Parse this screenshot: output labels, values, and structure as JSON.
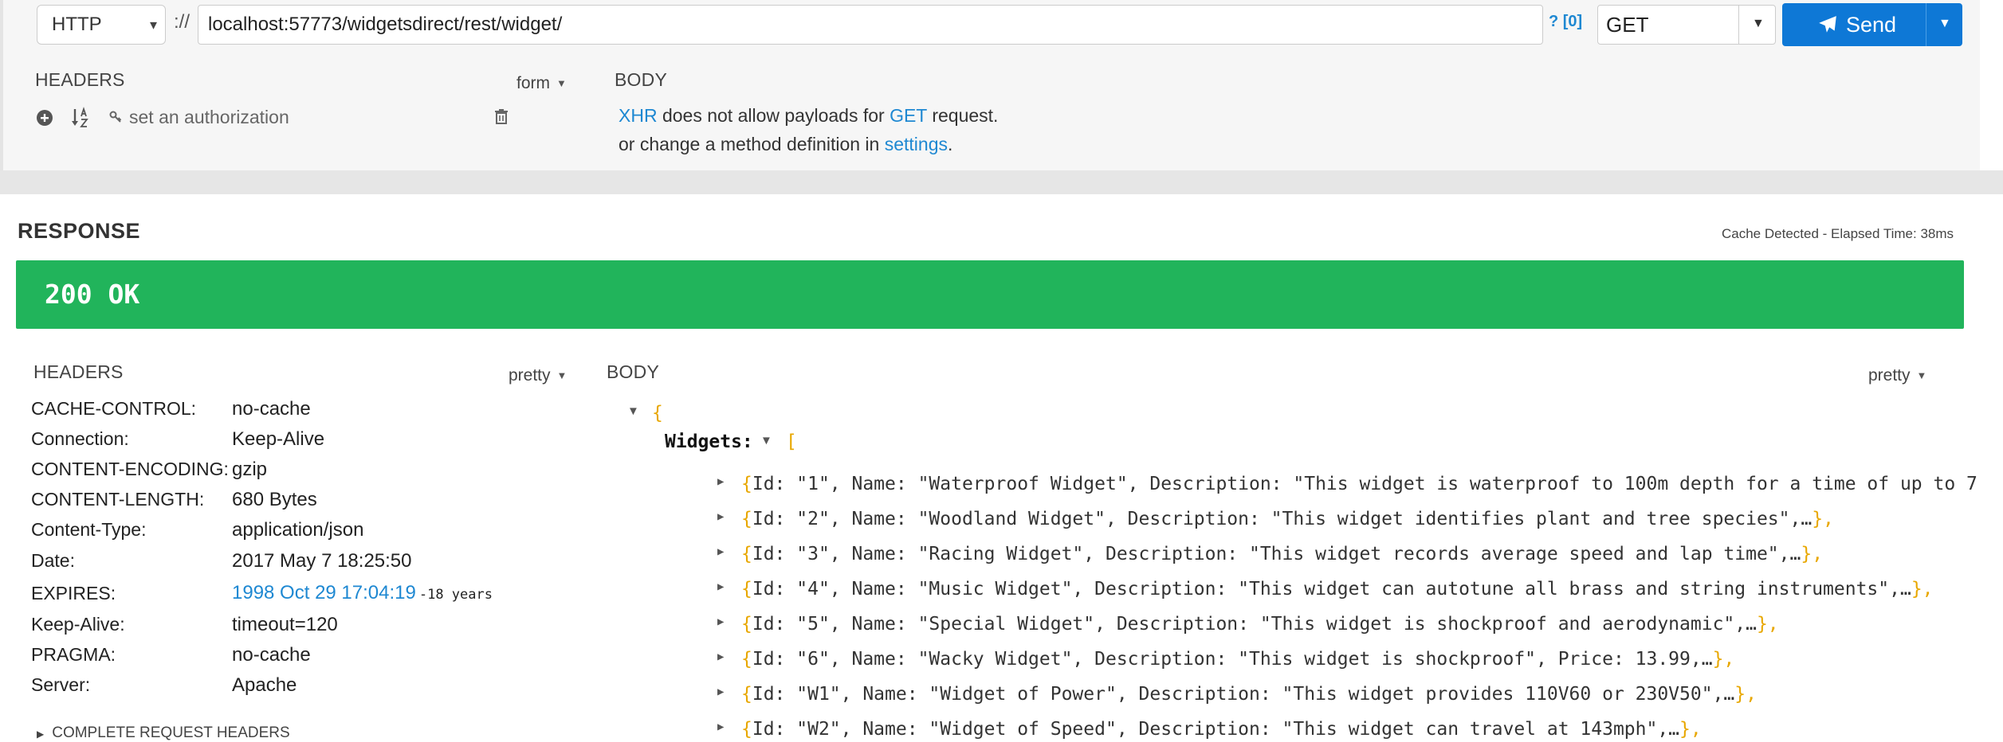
{
  "request": {
    "scheme": "HTTP",
    "separator": "://",
    "url": "localhost:57773/widgetsdirect/rest/widget/",
    "history": "? [0]",
    "method": "GET",
    "send_label": "Send",
    "headers_label": "HEADERS",
    "headers_toggle": "form",
    "auth_placeholder": "set an authorization",
    "body_label": "BODY",
    "body_message": {
      "xhr": "XHR",
      "part1": " does not allow payloads for ",
      "get": "GET",
      "part2": " request.",
      "line2": "or change a method definition in ",
      "settings": "settings",
      "period": "."
    }
  },
  "response": {
    "title": "RESPONSE",
    "elapsed": "Cache Detected - Elapsed Time: 38ms",
    "status": "200 OK",
    "headers_label": "HEADERS",
    "headers_toggle": "pretty",
    "body_label": "BODY",
    "body_toggle": "pretty",
    "headers": [
      {
        "key": "CACHE-CONTROL:",
        "value": "no-cache"
      },
      {
        "key": "Connection:",
        "value": "Keep-Alive"
      },
      {
        "key": "CONTENT-ENCODING:",
        "value": "gzip"
      },
      {
        "key": "CONTENT-LENGTH:",
        "value": "680 Bytes"
      },
      {
        "key": "Content-Type:",
        "value": "application/json"
      },
      {
        "key": "Date:",
        "value": "2017 May 7 18:25:50"
      },
      {
        "key": "EXPIRES:",
        "value": "1998 Oct 29 17:04:19",
        "suffix": "-18 years"
      },
      {
        "key": "Keep-Alive:",
        "value": "timeout=120"
      },
      {
        "key": "PRAGMA:",
        "value": "no-cache"
      },
      {
        "key": "Server:",
        "value": "Apache"
      }
    ],
    "complete_headers": "COMPLETE REQUEST HEADERS",
    "json": {
      "open_brace": "{",
      "widgets_key": "Widgets:",
      "open_bracket": "[",
      "items": [
        {
          "text": "Id:  \"1\", Name:  \"Waterproof Widget\", Description:  \"This widget is waterproof to 100m depth for a time of up to 7"
        },
        {
          "text": "Id:  \"2\", Name:  \"Woodland Widget\", Description:  \"This widget identifies plant and tree species\",…",
          "close": "},"
        },
        {
          "text": "Id:  \"3\", Name:  \"Racing Widget\", Description:  \"This widget records average speed and lap time\",…",
          "close": "},"
        },
        {
          "text": "Id:  \"4\", Name:  \"Music Widget\", Description:  \"This widget can autotune all brass and string instruments\",…",
          "close": "},"
        },
        {
          "text": "Id:  \"5\", Name:  \"Special Widget\", Description:  \"This widget is shockproof and aerodynamic\",…",
          "close": "},"
        },
        {
          "text": "Id:  \"6\", Name:  \"Wacky Widget\", Description:  \"This widget is shockproof\", Price:  13.99,…",
          "close": "},"
        },
        {
          "text": "Id:  \"W1\", Name:  \"Widget of Power\", Description:  \"This widget provides 110V60 or 230V50\",…",
          "close": "},"
        },
        {
          "text": "Id:  \"W2\", Name:  \"Widget of Speed\", Description:  \"This widget can travel at 143mph\",…",
          "close": "},"
        }
      ]
    }
  }
}
